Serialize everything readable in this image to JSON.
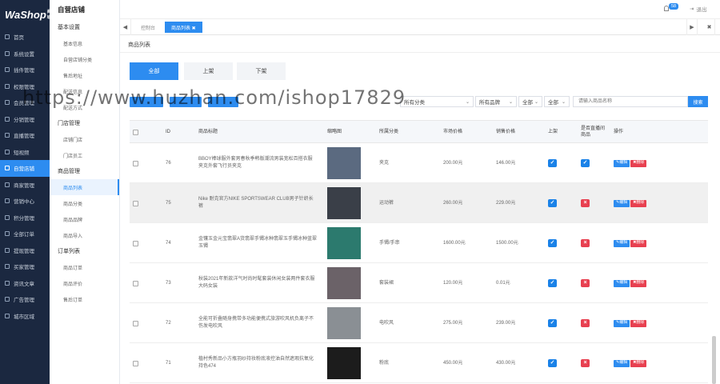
{
  "brand": {
    "logo": "WaShop",
    "logo_sup": "商城"
  },
  "nav": [
    {
      "label": "首页"
    },
    {
      "label": "系统设置"
    },
    {
      "label": "插件管理"
    },
    {
      "label": "权限管理"
    },
    {
      "label": "会员管理"
    },
    {
      "label": "分销管理"
    },
    {
      "label": "直播管理"
    },
    {
      "label": "短视频"
    },
    {
      "label": "自营店铺",
      "active": true
    },
    {
      "label": "商家管理"
    },
    {
      "label": "营销中心"
    },
    {
      "label": "积分管理"
    },
    {
      "label": "全部订单"
    },
    {
      "label": "提现管理"
    },
    {
      "label": "买家管理"
    },
    {
      "label": "资讯文章"
    },
    {
      "label": "广告管理"
    },
    {
      "label": "城市区域"
    }
  ],
  "submenu": {
    "title": "自营店铺",
    "groups": [
      {
        "label": "基本设置",
        "items": [
          "基本信息",
          "自营店铺分类",
          "售后地址",
          "配送信息",
          "配送方式"
        ]
      },
      {
        "label": "门店管理",
        "items": [
          "店铺门店",
          "门店员工"
        ]
      },
      {
        "label": "商品管理",
        "items": [
          "商品列表",
          "商品分类",
          "商品品牌",
          "商品导入"
        ]
      },
      {
        "label": "订单列表",
        "items": [
          "商品订单",
          "商品评价",
          "售后订单"
        ]
      }
    ]
  },
  "topbar": {
    "badge": "58",
    "exit": "退出"
  },
  "tabs": {
    "prev": "◀",
    "items": [
      {
        "label": "控制台"
      },
      {
        "label": "商品列表 ✖",
        "active": true
      }
    ],
    "next": "▶",
    "close": "✖"
  },
  "page": {
    "title": "商品列表"
  },
  "status_tabs": [
    "全部",
    "上架",
    "下架"
  ],
  "watermark": "https://www.huzhan.com/ishop17829",
  "filters": {
    "category": "所有分类",
    "brand": "所有品牌",
    "all1": "全部",
    "all2": "全部",
    "search_placeholder": "请输入商品名称",
    "search_btn": "搜索"
  },
  "table": {
    "headers": {
      "id": "ID",
      "title": "商品标题",
      "thumb": "缩略图",
      "category": "所属分类",
      "market": "市场价格",
      "sale": "销售价格",
      "shelf": "上架",
      "live": "是否直播间商品",
      "ops": "操作"
    },
    "rows": [
      {
        "id": "76",
        "title": "BBOY棒球服外套男春秋季韩版潮流男装宽松百搭衣服夹克外套飞行员夹克",
        "category": "夹克",
        "market": "200.00元",
        "sale": "146.00元",
        "shelf": true,
        "live": true,
        "color": "#5b6a80"
      },
      {
        "id": "75",
        "title": "Nike 耐克官方NIKE SPORTSWEAR CLUB男子针织长裤",
        "category": "运动裤",
        "market": "260.00元",
        "sale": "229.00元",
        "shelf": true,
        "live": false,
        "color": "#3a3f48"
      },
      {
        "id": "74",
        "title": "金镶玉金元宝翡翠A货翡翠手镯冰种翡翠玉手镯冰种蓝翠玉镯",
        "category": "手镯/手串",
        "market": "1600.00元",
        "sale": "1500.00元",
        "shelf": true,
        "live": false,
        "color": "#2c7a6e"
      },
      {
        "id": "73",
        "title": "秋装2021年新款洋气时尚时髦套装休闲女装两件套衣服大码女装",
        "category": "套装裙",
        "market": "120.00元",
        "sale": "0.01元",
        "shelf": true,
        "live": false,
        "color": "#6b6268"
      },
      {
        "id": "72",
        "title": "全能可折叠随身携带多功能便携式旅游吹风机负离子不伤发电吹风",
        "category": "电吹风",
        "market": "275.00元",
        "sale": "239.00元",
        "shelf": true,
        "live": false,
        "color": "#8a8f94"
      },
      {
        "id": "71",
        "title": "植村秀新品小方瓶羽纱持妆粉底液控油自然遮瑕抗氧化持色474",
        "category": "粉底",
        "market": "450.00元",
        "sale": "430.00元",
        "shelf": true,
        "live": false,
        "color": "#1c1c1c"
      }
    ],
    "actions": {
      "edit": "✎编辑",
      "del": "✖删除"
    }
  }
}
